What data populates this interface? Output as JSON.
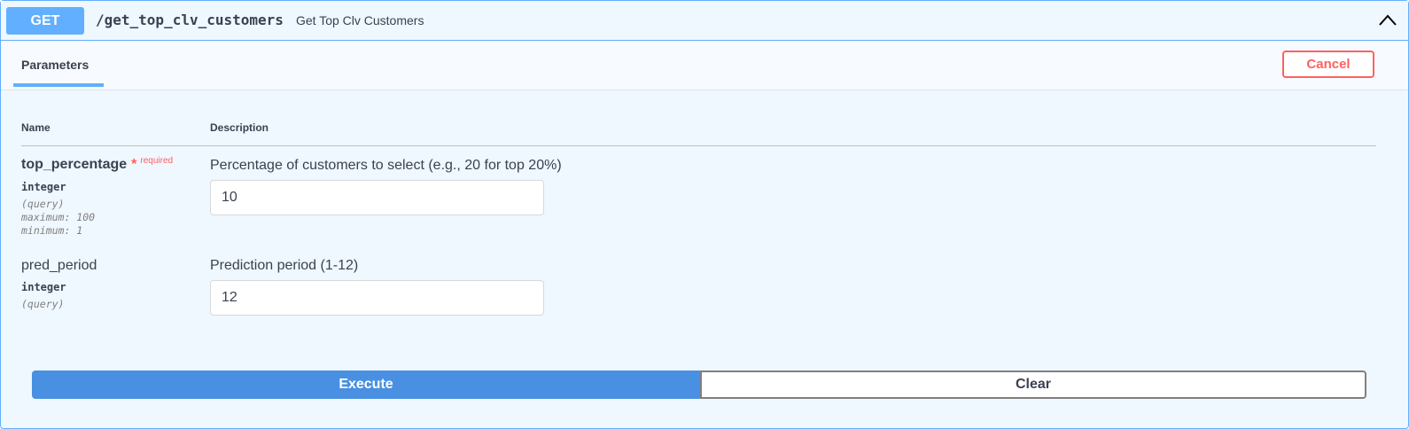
{
  "operation": {
    "method": "GET",
    "path": "/get_top_clv_customers",
    "summary": "Get Top Clv Customers",
    "expanded_icon": "chevron-up-icon"
  },
  "tabs": {
    "parameters_label": "Parameters",
    "cancel_label": "Cancel"
  },
  "table": {
    "name_header": "Name",
    "description_header": "Description"
  },
  "params": [
    {
      "name": "top_percentage",
      "star": "*",
      "required_label": "required",
      "type": "integer",
      "in": "(query)",
      "maximum": "maximum: 100",
      "minimum": "minimum: 1",
      "description": "Percentage of customers to select (e.g., 20 for top 20%)",
      "value": "10"
    },
    {
      "name": "pred_period",
      "type": "integer",
      "in": "(query)",
      "description": "Prediction period (1-12)",
      "value": "12"
    }
  ],
  "actions": {
    "execute_label": "Execute",
    "clear_label": "Clear"
  },
  "colors": {
    "get_accent": "#61affe",
    "execute": "#4990e2",
    "danger": "#ff6060"
  }
}
